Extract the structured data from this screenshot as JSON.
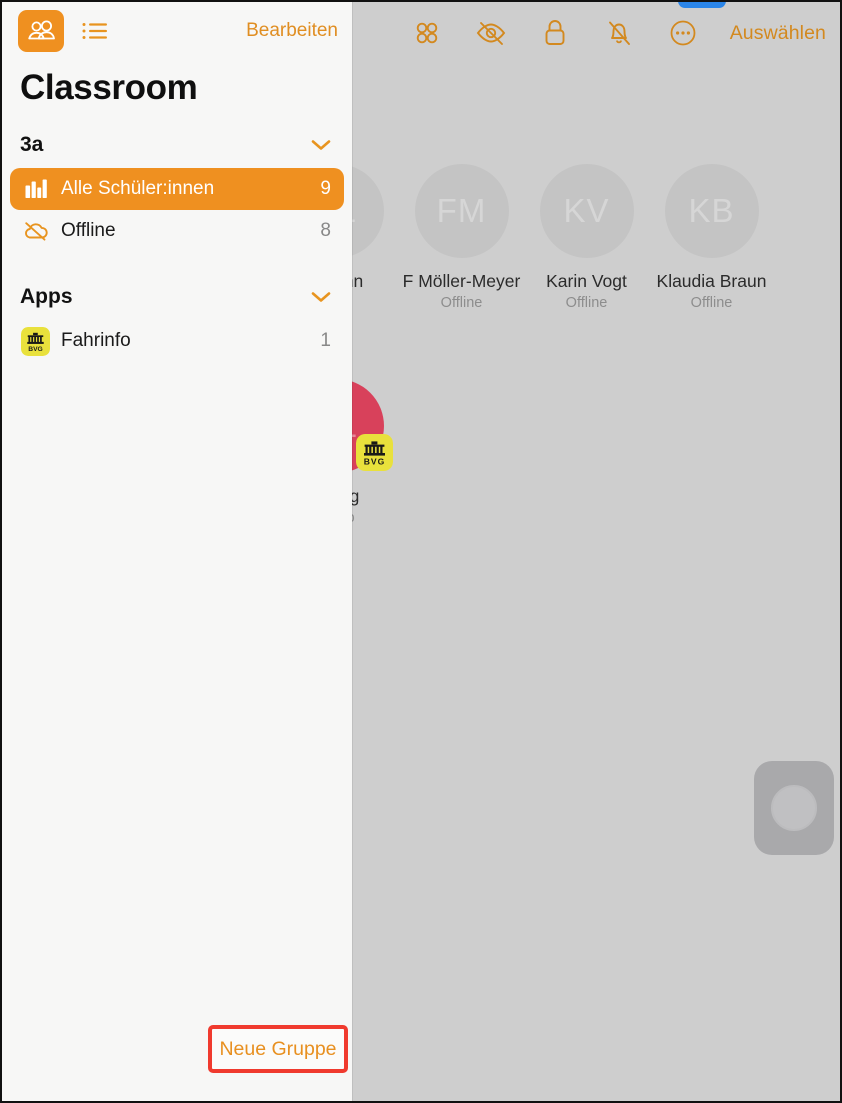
{
  "app": {
    "title": "Classroom",
    "accent_color": "#ef9020",
    "highlight_color": "#f03a2e",
    "sidebar_bg": "#f7f7f6",
    "main_bg": "#cecece"
  },
  "sidebar": {
    "topbar": {
      "people_tab_icon": "two-people-icon",
      "list_tab_icon": "bulleted-list-icon",
      "edit_label": "Bearbeiten"
    },
    "title": "Classroom",
    "sections": [
      {
        "title": "3a",
        "chevron": "chevron-down-icon",
        "rows": [
          {
            "icon": "books-icon",
            "label": "Alle Schüler:innen",
            "count": "9",
            "selected": true
          },
          {
            "icon": "cloud-slash-icon",
            "label": "Offline",
            "count": "8",
            "selected": false
          }
        ]
      },
      {
        "title": "Apps",
        "chevron": "chevron-down-icon",
        "rows": [
          {
            "icon": "bvg-fahrinfo-icon",
            "label": "Fahrinfo",
            "count": "1",
            "selected": false
          }
        ]
      }
    ],
    "footer": {
      "new_group_label": "Neue Gruppe",
      "highlighted": true
    }
  },
  "main": {
    "toolbar": {
      "icons": [
        {
          "name": "grid-four-circles-icon"
        },
        {
          "name": "eye-slash-icon"
        },
        {
          "name": "lock-icon"
        },
        {
          "name": "bell-slash-icon"
        },
        {
          "name": "ellipsis-circle-icon"
        }
      ],
      "select_label": "Auswählen"
    },
    "students": [
      [
        {
          "initials": "FL",
          "name": "hmann",
          "status": "ffline",
          "tinted": false,
          "badge": null
        },
        {
          "initials": "FM",
          "name": "F Möller-Meyer",
          "status": "Offline",
          "tinted": false,
          "badge": null
        },
        {
          "initials": "KV",
          "name": "Karin Vogt",
          "status": "Offline",
          "tinted": false,
          "badge": null
        },
        {
          "initials": "KB",
          "name": "Klaudia Braun",
          "status": "Offline",
          "tinted": false,
          "badge": null
        }
      ],
      [
        {
          "initials": "SL",
          "name": "udwig",
          "status": "hrinfo",
          "tinted": true,
          "badge": "bvg-fahrinfo-icon"
        }
      ]
    ],
    "record_button": "record-home-button"
  }
}
